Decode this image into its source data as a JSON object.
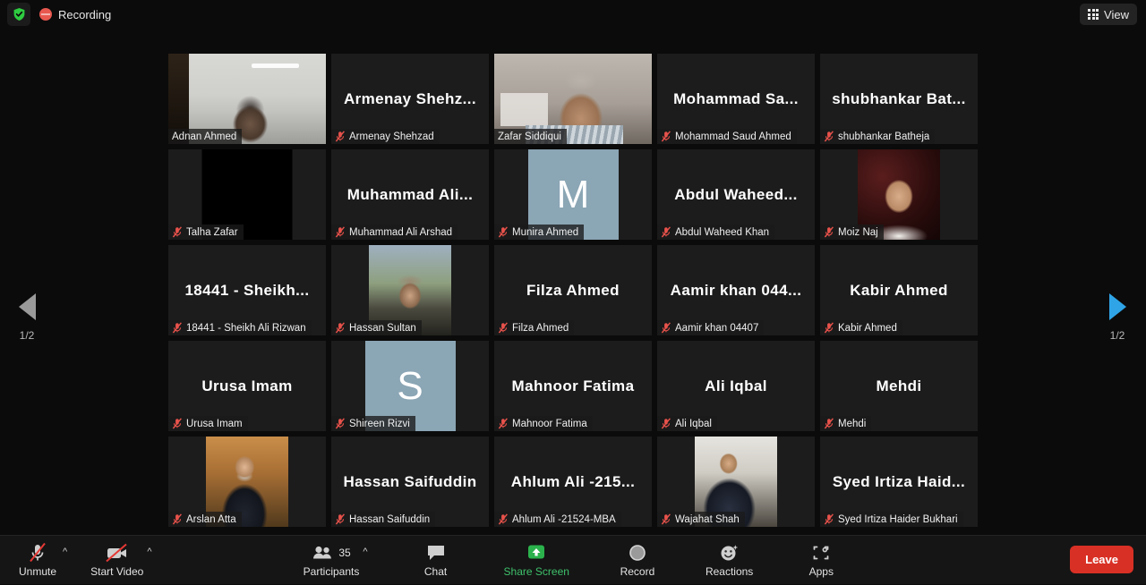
{
  "topbar": {
    "encryption_icon": "shield-check-icon",
    "recording_icon": "recording-indicator-icon",
    "recording_label": "Recording",
    "view_icon": "grid-view-icon",
    "view_label": "View"
  },
  "pager": {
    "prev_icon": "chevron-left-triangle-icon",
    "next_icon": "chevron-right-triangle-icon",
    "prev_label": "1/2",
    "next_label": "1/2",
    "prev_color": "#9a9a9a",
    "next_color": "#2fa5e8"
  },
  "gallery": {
    "active_border_color": "#cddc39",
    "columns": 5,
    "rows": 5,
    "tiles": [
      {
        "display_name": "",
        "name": "Adnan Ahmed",
        "muted": false,
        "kind": "video",
        "media": "vid-adnan",
        "shape": "full",
        "active": false
      },
      {
        "display_name": "Armenay  Shehz...",
        "name": "Armenay Shehzad",
        "muted": true,
        "kind": "name",
        "media": "",
        "shape": "",
        "active": false
      },
      {
        "display_name": "",
        "name": "Zafar Siddiqui",
        "muted": false,
        "kind": "video",
        "media": "vid-zafar",
        "shape": "full",
        "active": true
      },
      {
        "display_name": "Mohammad  Sa...",
        "name": "Mohammad Saud Ahmed",
        "muted": true,
        "kind": "name",
        "media": "",
        "shape": "",
        "active": false
      },
      {
        "display_name": "shubhankar  Bat...",
        "name": "shubhankar Batheja",
        "muted": true,
        "kind": "name",
        "media": "",
        "shape": "",
        "active": false
      },
      {
        "display_name": "",
        "name": "Talha Zafar",
        "muted": true,
        "kind": "video",
        "media": "vid-black",
        "shape": "square",
        "active": false
      },
      {
        "display_name": "Muhammad  Ali...",
        "name": "Muhammad Ali Arshad",
        "muted": true,
        "kind": "name",
        "media": "",
        "shape": "",
        "active": false
      },
      {
        "display_name": "",
        "name": "Munira Ahmed",
        "muted": true,
        "kind": "avatar",
        "avatar_letter": "M",
        "avatar_color": "#8ba6b5",
        "shape": "square",
        "active": false
      },
      {
        "display_name": "Abdul  Waheed...",
        "name": "Abdul Waheed Khan",
        "muted": true,
        "kind": "name",
        "media": "",
        "shape": "",
        "active": false
      },
      {
        "display_name": "",
        "name": "Moiz Naj",
        "muted": true,
        "kind": "photo",
        "media": "ph-moiz",
        "shape": "squarephoto",
        "active": false
      },
      {
        "display_name": "18441 - Sheikh...",
        "name": "18441 - Sheikh Ali Rizwan",
        "muted": true,
        "kind": "name",
        "media": "",
        "shape": "",
        "active": false
      },
      {
        "display_name": "",
        "name": "Hassan Sultan",
        "muted": true,
        "kind": "photo",
        "media": "ph-hassansultan",
        "shape": "squarephoto",
        "active": false
      },
      {
        "display_name": "Filza Ahmed",
        "name": "Filza Ahmed",
        "muted": true,
        "kind": "name",
        "media": "",
        "shape": "",
        "active": false
      },
      {
        "display_name": "Aamir  khan  044...",
        "name": "Aamir khan 04407",
        "muted": true,
        "kind": "name",
        "media": "",
        "shape": "",
        "active": false
      },
      {
        "display_name": "Kabir Ahmed",
        "name": "Kabir Ahmed",
        "muted": true,
        "kind": "name",
        "media": "",
        "shape": "",
        "active": false
      },
      {
        "display_name": "Urusa Imam",
        "name": "Urusa Imam",
        "muted": true,
        "kind": "name",
        "media": "",
        "shape": "",
        "active": false
      },
      {
        "display_name": "",
        "name": "Shireen Rizvi",
        "muted": true,
        "kind": "avatar",
        "avatar_letter": "S",
        "avatar_color": "#8ba6b5",
        "shape": "square",
        "active": false
      },
      {
        "display_name": "Mahnoor Fatima",
        "name": "Mahnoor Fatima",
        "muted": true,
        "kind": "name",
        "media": "",
        "shape": "",
        "active": false
      },
      {
        "display_name": "Ali Iqbal",
        "name": "Ali Iqbal",
        "muted": true,
        "kind": "name",
        "media": "",
        "shape": "",
        "active": false
      },
      {
        "display_name": "Mehdi",
        "name": "Mehdi",
        "muted": true,
        "kind": "name",
        "media": "",
        "shape": "",
        "active": false
      },
      {
        "display_name": "",
        "name": "Arslan Atta",
        "muted": true,
        "kind": "photo",
        "media": "ph-arslan",
        "shape": "squarephoto",
        "active": false
      },
      {
        "display_name": "Hassan Saifuddin",
        "name": "Hassan Saifuddin",
        "muted": true,
        "kind": "name",
        "media": "",
        "shape": "",
        "active": false
      },
      {
        "display_name": "Ahlum Ali -215...",
        "name": "Ahlum Ali -21524-MBA",
        "muted": true,
        "kind": "name",
        "media": "",
        "shape": "",
        "active": false
      },
      {
        "display_name": "",
        "name": "Wajahat Shah",
        "muted": true,
        "kind": "photo",
        "media": "ph-wajahat",
        "shape": "squarephoto",
        "active": false
      },
      {
        "display_name": "Syed  Irtiza  Haid...",
        "name": "Syed Irtiza Haider Bukhari",
        "muted": true,
        "kind": "name",
        "media": "",
        "shape": "",
        "active": false
      }
    ]
  },
  "toolbar": {
    "mute": {
      "label": "Unmute",
      "icon": "microphone-muted-icon",
      "caret": "audio-options-caret"
    },
    "video": {
      "label": "Start Video",
      "icon": "camera-off-icon",
      "caret": "video-options-caret"
    },
    "participants": {
      "label": "Participants",
      "icon": "participants-icon",
      "count": "35",
      "caret": "participants-caret"
    },
    "chat": {
      "label": "Chat",
      "icon": "chat-bubble-icon"
    },
    "share": {
      "label": "Share Screen",
      "icon": "share-screen-arrow-icon",
      "color": "#3ec16b"
    },
    "record": {
      "label": "Record",
      "icon": "record-circle-icon"
    },
    "reactions": {
      "label": "Reactions",
      "icon": "reactions-smiley-icon"
    },
    "apps": {
      "label": "Apps",
      "icon": "apps-bracket-icon"
    },
    "leave": {
      "label": "Leave",
      "color": "#d93025"
    }
  }
}
